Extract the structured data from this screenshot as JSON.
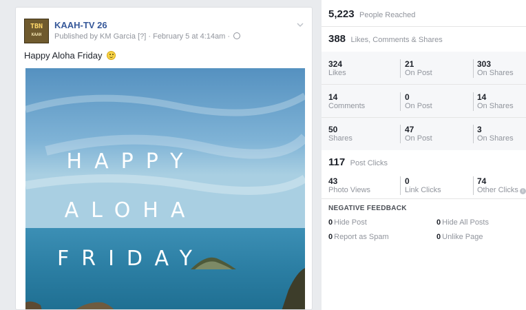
{
  "post": {
    "page_name": "KAAH-TV 26",
    "avatar_text": "TBN",
    "avatar_subtext": "KAAH",
    "published_by": "Published by KM Garcia",
    "help_marker": "[?]",
    "date": "February 5 at 4:14am",
    "separator": "·",
    "text": "Happy Aloha Friday",
    "image_words": [
      "HAPPY",
      "ALOHA",
      "FRIDAY"
    ],
    "icons": {
      "privacy": "globe-icon",
      "menu": "chevron-down-icon",
      "emoji": "smiley-emoji-icon"
    },
    "colors": {
      "link": "#365899",
      "sky": "#6aa6cf",
      "ocean": "#2f84a6"
    }
  },
  "insights": {
    "reach": {
      "value": "5,223",
      "label": "People Reached"
    },
    "engagement": {
      "value": "388",
      "label": "Likes, Comments & Shares"
    },
    "rows": [
      {
        "cells": [
          {
            "num": "324",
            "label": "Likes"
          },
          {
            "num": "21",
            "label": "On Post"
          },
          {
            "num": "303",
            "label": "On Shares"
          }
        ]
      },
      {
        "cells": [
          {
            "num": "14",
            "label": "Comments"
          },
          {
            "num": "0",
            "label": "On Post"
          },
          {
            "num": "14",
            "label": "On Shares"
          }
        ]
      },
      {
        "cells": [
          {
            "num": "50",
            "label": "Shares"
          },
          {
            "num": "47",
            "label": "On Post"
          },
          {
            "num": "3",
            "label": "On Shares"
          }
        ]
      }
    ],
    "clicks": {
      "value": "117",
      "label": "Post Clicks",
      "cells": [
        {
          "num": "43",
          "label": "Photo Views"
        },
        {
          "num": "0",
          "label": "Link Clicks"
        },
        {
          "num": "74",
          "label": "Other Clicks"
        }
      ],
      "info_icon": "info-icon"
    },
    "negative": {
      "title": "NEGATIVE FEEDBACK",
      "items": [
        {
          "num": "0",
          "label": "Hide Post"
        },
        {
          "num": "0",
          "label": "Hide All Posts"
        },
        {
          "num": "0",
          "label": "Report as Spam"
        },
        {
          "num": "0",
          "label": "Unlike Page"
        }
      ]
    }
  }
}
